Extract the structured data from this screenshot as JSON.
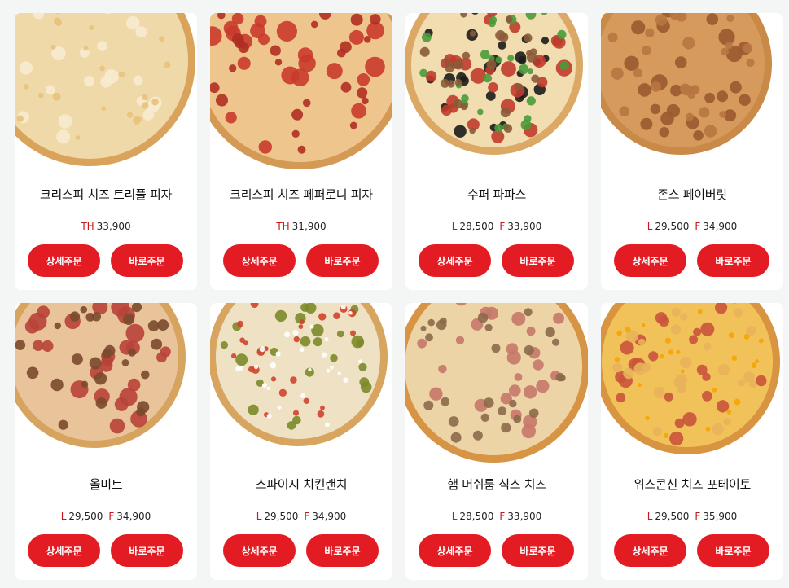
{
  "buttons": {
    "detail_label": "상세주문",
    "quick_label": "바로주문"
  },
  "colors": {
    "accent": "#e31b23",
    "size_code": "#c8161d"
  },
  "products": [
    {
      "name": "크리스피 치즈 트리플 피자",
      "prices": [
        {
          "size": "TH",
          "amount": "33,900"
        }
      ],
      "image": "pizza-crispy-cheese-triple"
    },
    {
      "name": "크리스피 치즈 페퍼로니 피자",
      "prices": [
        {
          "size": "TH",
          "amount": "31,900"
        }
      ],
      "image": "pizza-crispy-cheese-pepperoni"
    },
    {
      "name": "수퍼 파파스",
      "prices": [
        {
          "size": "L",
          "amount": "28,500"
        },
        {
          "size": "F",
          "amount": "33,900"
        }
      ],
      "image": "pizza-super-papas"
    },
    {
      "name": "존스 페이버릿",
      "prices": [
        {
          "size": "L",
          "amount": "29,500"
        },
        {
          "size": "F",
          "amount": "34,900"
        }
      ],
      "image": "pizza-johns-favorite"
    },
    {
      "name": "올미트",
      "prices": [
        {
          "size": "L",
          "amount": "29,500"
        },
        {
          "size": "F",
          "amount": "34,900"
        }
      ],
      "image": "pizza-all-meat"
    },
    {
      "name": "스파이시 치킨랜치",
      "prices": [
        {
          "size": "L",
          "amount": "29,500"
        },
        {
          "size": "F",
          "amount": "34,900"
        }
      ],
      "image": "pizza-spicy-chicken-ranch"
    },
    {
      "name": "햄 머쉬룸 식스 치즈",
      "prices": [
        {
          "size": "L",
          "amount": "28,500"
        },
        {
          "size": "F",
          "amount": "33,900"
        }
      ],
      "image": "pizza-ham-mushroom-six-cheese"
    },
    {
      "name": "위스콘신 치즈 포테이토",
      "prices": [
        {
          "size": "L",
          "amount": "29,500"
        },
        {
          "size": "F",
          "amount": "35,900"
        }
      ],
      "image": "pizza-wisconsin-cheese-potato"
    }
  ]
}
